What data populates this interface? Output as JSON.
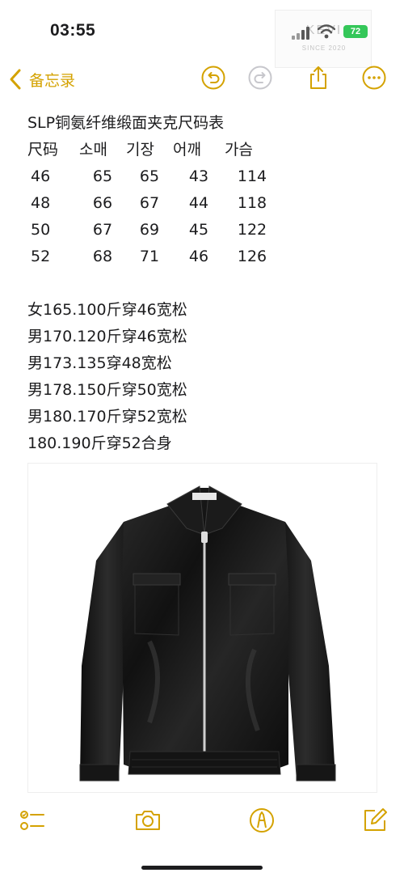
{
  "status_bar": {
    "time": "03:55",
    "battery": "72",
    "watermark_text": "KEVI",
    "watermark_sub": "SINCE 2020"
  },
  "nav": {
    "back_label": "备忘录",
    "accent_color": "#d4a200"
  },
  "note": {
    "title": "SLP铜氨纤维缎面夹克尺码表",
    "table_headers": [
      "尺码",
      "소매",
      "기장",
      "어깨",
      "가슴"
    ],
    "table_rows": [
      [
        "46",
        "65",
        "65",
        "43",
        "114"
      ],
      [
        "48",
        "66",
        "67",
        "44",
        "118"
      ],
      [
        "50",
        "67",
        "69",
        "45",
        "122"
      ],
      [
        "52",
        "68",
        "71",
        "46",
        "126"
      ]
    ],
    "fit_lines": [
      "女165.100斤穿46宽松",
      "男170.120斤穿46宽松",
      "男173.135穿48宽松",
      "男178.150斤穿50宽松",
      "男180.170斤穿52宽松",
      "180.190斤穿52合身"
    ]
  },
  "toolbar": {
    "icons": [
      "checklist-icon",
      "camera-icon",
      "markup-pen-icon",
      "compose-icon"
    ]
  }
}
